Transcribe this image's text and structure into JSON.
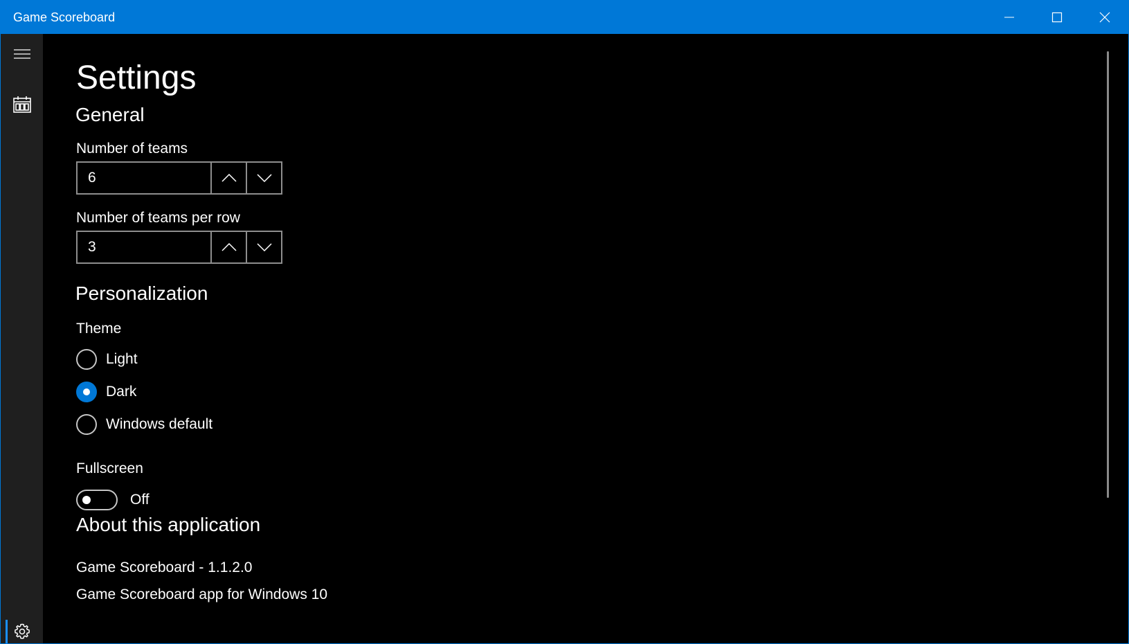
{
  "window": {
    "title": "Game Scoreboard"
  },
  "page": {
    "title": "Settings"
  },
  "general": {
    "heading": "General",
    "teams": {
      "label": "Number of teams",
      "value": "6"
    },
    "teams_per_row": {
      "label": "Number of teams per row",
      "value": "3"
    }
  },
  "personalization": {
    "heading": "Personalization",
    "theme": {
      "label": "Theme",
      "options": [
        "Light",
        "Dark",
        "Windows default"
      ],
      "selected": "Dark"
    },
    "fullscreen": {
      "label": "Fullscreen",
      "state": "Off"
    }
  },
  "about": {
    "heading": "About this application",
    "version_line": "Game Scoreboard - 1.1.2.0",
    "description": "Game Scoreboard app for Windows 10"
  },
  "colors": {
    "accent": "#0078d7",
    "background": "#000000",
    "nav_pane": "#1f1f1f"
  }
}
